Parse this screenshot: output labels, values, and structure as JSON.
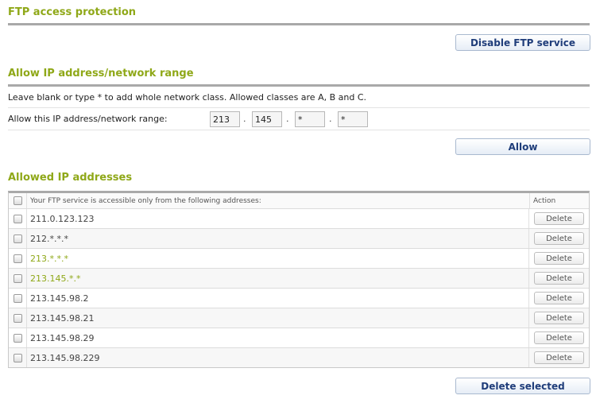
{
  "ftp_protection": {
    "title": "FTP access protection",
    "disable_button": "Disable FTP service"
  },
  "allow_range": {
    "title": "Allow IP address/network range",
    "help_text": "Leave blank or type * to add whole network class. Allowed classes are A, B and C.",
    "ip_label": "Allow this IP address/network range:",
    "octets": [
      "213",
      "145",
      "*",
      "*"
    ],
    "separator": ".",
    "allow_button": "Allow"
  },
  "allowed_ips": {
    "title": "Allowed IP addresses",
    "header_address": "Your FTP service is accessible only from the following addresses:",
    "header_action": "Action",
    "delete_label": "Delete",
    "highlight_color": "#8fa818",
    "rows": [
      {
        "address": "211.0.123.123",
        "highlighted": false
      },
      {
        "address": "212.*.*.*",
        "highlighted": false
      },
      {
        "address": "213.*.*.*",
        "highlighted": true
      },
      {
        "address": "213.145.*.*",
        "highlighted": true
      },
      {
        "address": "213.145.98.2",
        "highlighted": false
      },
      {
        "address": "213.145.98.21",
        "highlighted": false
      },
      {
        "address": "213.145.98.29",
        "highlighted": false
      },
      {
        "address": "213.145.98.229",
        "highlighted": false
      }
    ],
    "delete_selected_button": "Delete selected"
  }
}
